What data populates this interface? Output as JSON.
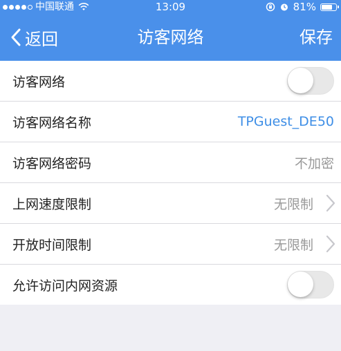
{
  "status_bar": {
    "carrier": "中国联通",
    "time": "13:09",
    "battery_percent": "81%",
    "battery_level": 0.81,
    "signal_bars_filled": 4,
    "signal_bars_total": 5
  },
  "nav": {
    "back_label": "返回",
    "title": "访客网络",
    "save_label": "保存"
  },
  "rows": [
    {
      "label": "访客网络",
      "type": "toggle",
      "on": false
    },
    {
      "label": "访客网络名称",
      "value": "TPGuest_DE50",
      "type": "value-link"
    },
    {
      "label": "访客网络密码",
      "value": "不加密",
      "type": "value"
    },
    {
      "label": "上网速度限制",
      "value": "无限制",
      "type": "chevron"
    },
    {
      "label": "开放时间限制",
      "value": "无限制",
      "type": "chevron"
    },
    {
      "label": "允许访问内网资源",
      "type": "toggle",
      "on": false
    }
  ],
  "colors": {
    "accent": "#4a90ea",
    "link": "#3e8ee6",
    "background": "#efeff4"
  }
}
